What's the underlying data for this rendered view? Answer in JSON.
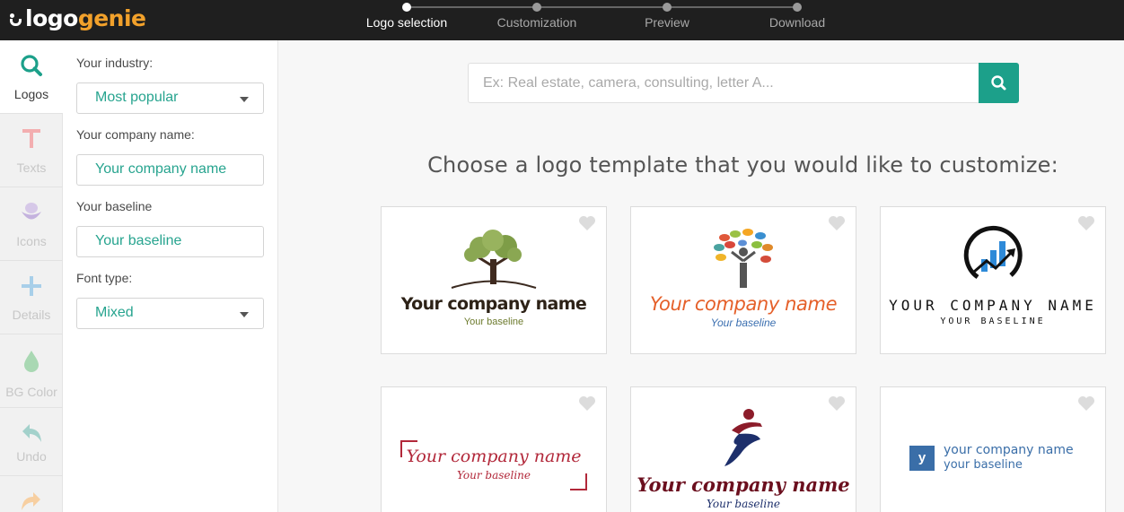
{
  "brand": {
    "part1": "logo",
    "part2": "genie"
  },
  "steps": [
    {
      "label": "Logo selection",
      "active": true
    },
    {
      "label": "Customization",
      "active": false
    },
    {
      "label": "Preview",
      "active": false
    },
    {
      "label": "Download",
      "active": false
    }
  ],
  "rail": [
    {
      "label": "Logos",
      "icon": "search-icon"
    },
    {
      "label": "Texts",
      "icon": "text-icon"
    },
    {
      "label": "Icons",
      "icon": "flower-icon"
    },
    {
      "label": "Details",
      "icon": "plus-icon"
    },
    {
      "label": "BG Color",
      "icon": "drop-icon"
    },
    {
      "label": "Undo",
      "icon": "undo-icon"
    },
    {
      "label": "",
      "icon": "redo-icon"
    }
  ],
  "form": {
    "industry_label": "Your industry:",
    "industry_value": "Most popular",
    "company_label": "Your company name:",
    "company_value": "Your company name",
    "baseline_label": "Your baseline",
    "baseline_value": "Your baseline",
    "font_label": "Font type:",
    "font_value": "Mixed"
  },
  "search": {
    "placeholder": "Ex: Real estate, camera, consulting, letter A..."
  },
  "heading": "Choose a logo template that you would like to customize:",
  "cards": [
    {
      "name": "Your company name",
      "baseline": "Your baseline"
    },
    {
      "name": "Your company name",
      "baseline": "Your baseline"
    },
    {
      "name": "YOUR COMPANY NAME",
      "baseline": "YOUR BASELINE"
    },
    {
      "name": "Your company name",
      "baseline": "Your baseline"
    },
    {
      "name": "Your company name",
      "baseline": "Your baseline"
    },
    {
      "name": "your company name",
      "baseline": "your baseline",
      "monogram": "y"
    }
  ],
  "colors": {
    "accent": "#1ca08a",
    "topbar": "#1f1f1f",
    "brand_orange": "#f2a12b"
  }
}
